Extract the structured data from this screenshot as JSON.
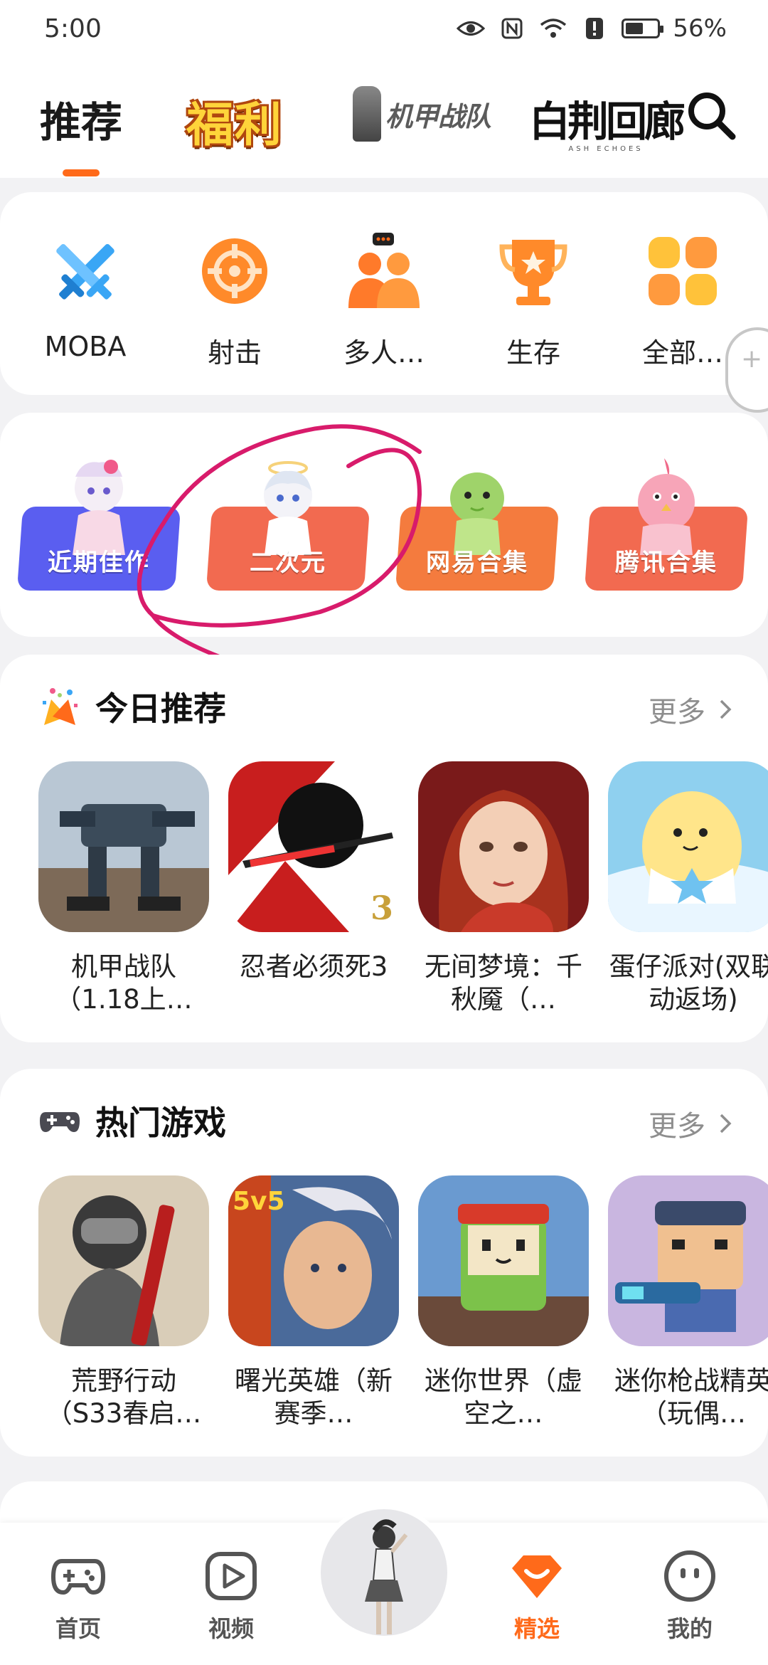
{
  "status": {
    "time": "5:00",
    "battery": "56%",
    "battery_level": 0.56
  },
  "top_tabs": {
    "recommend": "推荐",
    "welfare": "福利",
    "mech": "机甲战队",
    "corridor": "白荆回廊",
    "corridor_sub": "ASH ECHOES"
  },
  "categories": [
    {
      "label": "MOBA",
      "icon": "crossed-swords-icon"
    },
    {
      "label": "射击",
      "icon": "crosshair-icon"
    },
    {
      "label": "多人…",
      "icon": "multiplayer-icon"
    },
    {
      "label": "生存",
      "icon": "trophy-icon"
    },
    {
      "label": "全部…",
      "icon": "grid-icon"
    }
  ],
  "collections": [
    {
      "label": "近期佳作",
      "color": "#5a5ef0"
    },
    {
      "label": "二次元",
      "color": "#f26a50"
    },
    {
      "label": "网易合集",
      "color": "#f47b3e"
    },
    {
      "label": "腾讯合集",
      "color": "#f26a50"
    }
  ],
  "today": {
    "title": "今日推荐",
    "more": "更多",
    "games": [
      {
        "name": "机甲战队（1.18上…"
      },
      {
        "name": "忍者必须死3"
      },
      {
        "name": "无间梦境：千秋魇（…"
      },
      {
        "name": "蛋仔派对(双联动返场)"
      }
    ]
  },
  "hot": {
    "title": "热门游戏",
    "more": "更多",
    "games": [
      {
        "name": "荒野行动（S33春启…"
      },
      {
        "name": "曙光英雄（新赛季…"
      },
      {
        "name": "迷你世界（虚空之…"
      },
      {
        "name": "迷你枪战精英（玩偶…"
      }
    ]
  },
  "nav": {
    "home": "首页",
    "video": "视频",
    "featured": "精选",
    "mine": "我的"
  },
  "colors": {
    "accent": "#ff6a1a",
    "annotation": "#d81b6b"
  }
}
